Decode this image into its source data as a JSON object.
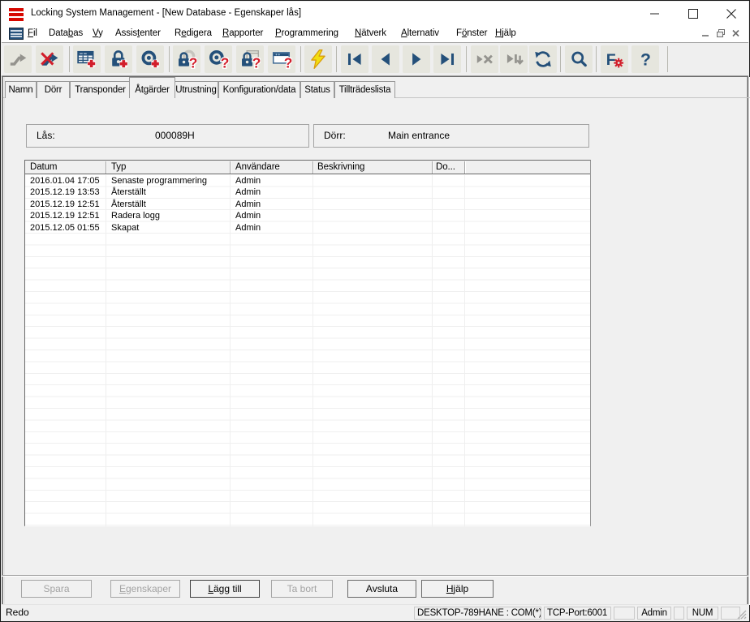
{
  "window": {
    "title": "Locking System Management - [New Database - Egenskaper lås]",
    "controls": [
      "minimize",
      "maximize",
      "close"
    ]
  },
  "menu": {
    "items": [
      {
        "label": "Fil",
        "u": 0
      },
      {
        "label": "Databas",
        "u": 4
      },
      {
        "label": "Vy",
        "u": 0
      },
      {
        "label": "Assistenter",
        "u": 5
      },
      {
        "label": "Redigera",
        "u": 1
      },
      {
        "label": "Rapporter",
        "u": 0
      },
      {
        "label": "Programmering",
        "u": 0
      },
      {
        "label": "Nätverk",
        "u": 0
      },
      {
        "label": "Alternativ",
        "u": 0
      },
      {
        "label": "Fönster",
        "u": 1
      },
      {
        "label": "Hjälp",
        "u": 0
      }
    ],
    "mdi_controls": [
      "minimize",
      "restore",
      "close"
    ]
  },
  "toolbar": {
    "buttons": [
      {
        "icon": "zigzag-arrow-icon",
        "disabled": true
      },
      {
        "icon": "zigzag-arrow-delete-icon",
        "disabled": false
      },
      {
        "icon": "matrix-add-icon",
        "disabled": false
      },
      {
        "icon": "lock-add-icon",
        "disabled": false
      },
      {
        "icon": "transponder-add-icon",
        "disabled": false
      },
      {
        "icon": "lock-read-icon",
        "disabled": false
      },
      {
        "icon": "transponder-read-icon",
        "disabled": false
      },
      {
        "icon": "lock-network-read-icon",
        "disabled": false
      },
      {
        "icon": "window-read-icon",
        "disabled": false
      },
      {
        "icon": "program-flash-icon",
        "disabled": false
      },
      {
        "icon": "nav-first-icon",
        "disabled": false
      },
      {
        "icon": "nav-prev-icon",
        "disabled": false
      },
      {
        "icon": "nav-next-icon",
        "disabled": false
      },
      {
        "icon": "nav-last-icon",
        "disabled": false
      },
      {
        "icon": "nav-cancel-icon",
        "disabled": true
      },
      {
        "icon": "nav-jump-icon",
        "disabled": true
      },
      {
        "icon": "refresh-icon",
        "disabled": false
      },
      {
        "icon": "search-icon",
        "disabled": false
      },
      {
        "icon": "filter-config-icon",
        "disabled": false
      },
      {
        "icon": "help-icon",
        "disabled": false
      }
    ]
  },
  "tabs": {
    "items": [
      {
        "label": "Namn",
        "active": false
      },
      {
        "label": "Dörr",
        "active": false
      },
      {
        "label": "Transponder",
        "active": false
      },
      {
        "label": "Åtgärder",
        "active": true
      },
      {
        "label": "Utrustning",
        "active": false
      },
      {
        "label": "Konfiguration/data",
        "active": false
      },
      {
        "label": "Status",
        "active": false
      },
      {
        "label": "Tillträdeslista",
        "active": false
      }
    ]
  },
  "fields": {
    "lock_label": "Lås:",
    "lock_value": "000089H",
    "door_label": "Dörr:",
    "door_value": "Main entrance"
  },
  "table": {
    "columns": [
      "Datum",
      "Typ",
      "Användare",
      "Beskrivning",
      "Do...",
      ""
    ],
    "rows": [
      [
        "2016.01.04 17:05",
        "Senaste programmering",
        "Admin",
        "",
        "",
        ""
      ],
      [
        "2015.12.19 13:53",
        "Återställt",
        "Admin",
        "",
        "",
        ""
      ],
      [
        "2015.12.19 12:51",
        "Återställt",
        "Admin",
        "",
        "",
        ""
      ],
      [
        "2015.12.19 12:51",
        "Radera logg",
        "Admin",
        "",
        "",
        ""
      ],
      [
        "2015.12.05 01:55",
        "Skapat",
        "Admin",
        "",
        "",
        ""
      ]
    ]
  },
  "buttons": [
    {
      "label": "Spara",
      "disabled": true,
      "u": -1
    },
    {
      "label": "Egenskaper",
      "disabled": true,
      "u": 0
    },
    {
      "label": "Lägg till",
      "disabled": false,
      "u": 0,
      "default": true
    },
    {
      "label": "Ta bort",
      "disabled": true,
      "u": -1
    },
    {
      "label": "Avsluta",
      "disabled": false,
      "u": -1
    },
    {
      "label": "Hjälp",
      "disabled": false,
      "u": 0
    }
  ],
  "statusbar": {
    "ready_text": "Redo",
    "panels": [
      {
        "text": "DESKTOP-789HANE : COM(*)"
      },
      {
        "text": "TCP-Port:6001"
      },
      {
        "text": ""
      },
      {
        "text": "Admin"
      },
      {
        "text": ""
      },
      {
        "text": "NUM"
      },
      {
        "text": ""
      }
    ]
  }
}
